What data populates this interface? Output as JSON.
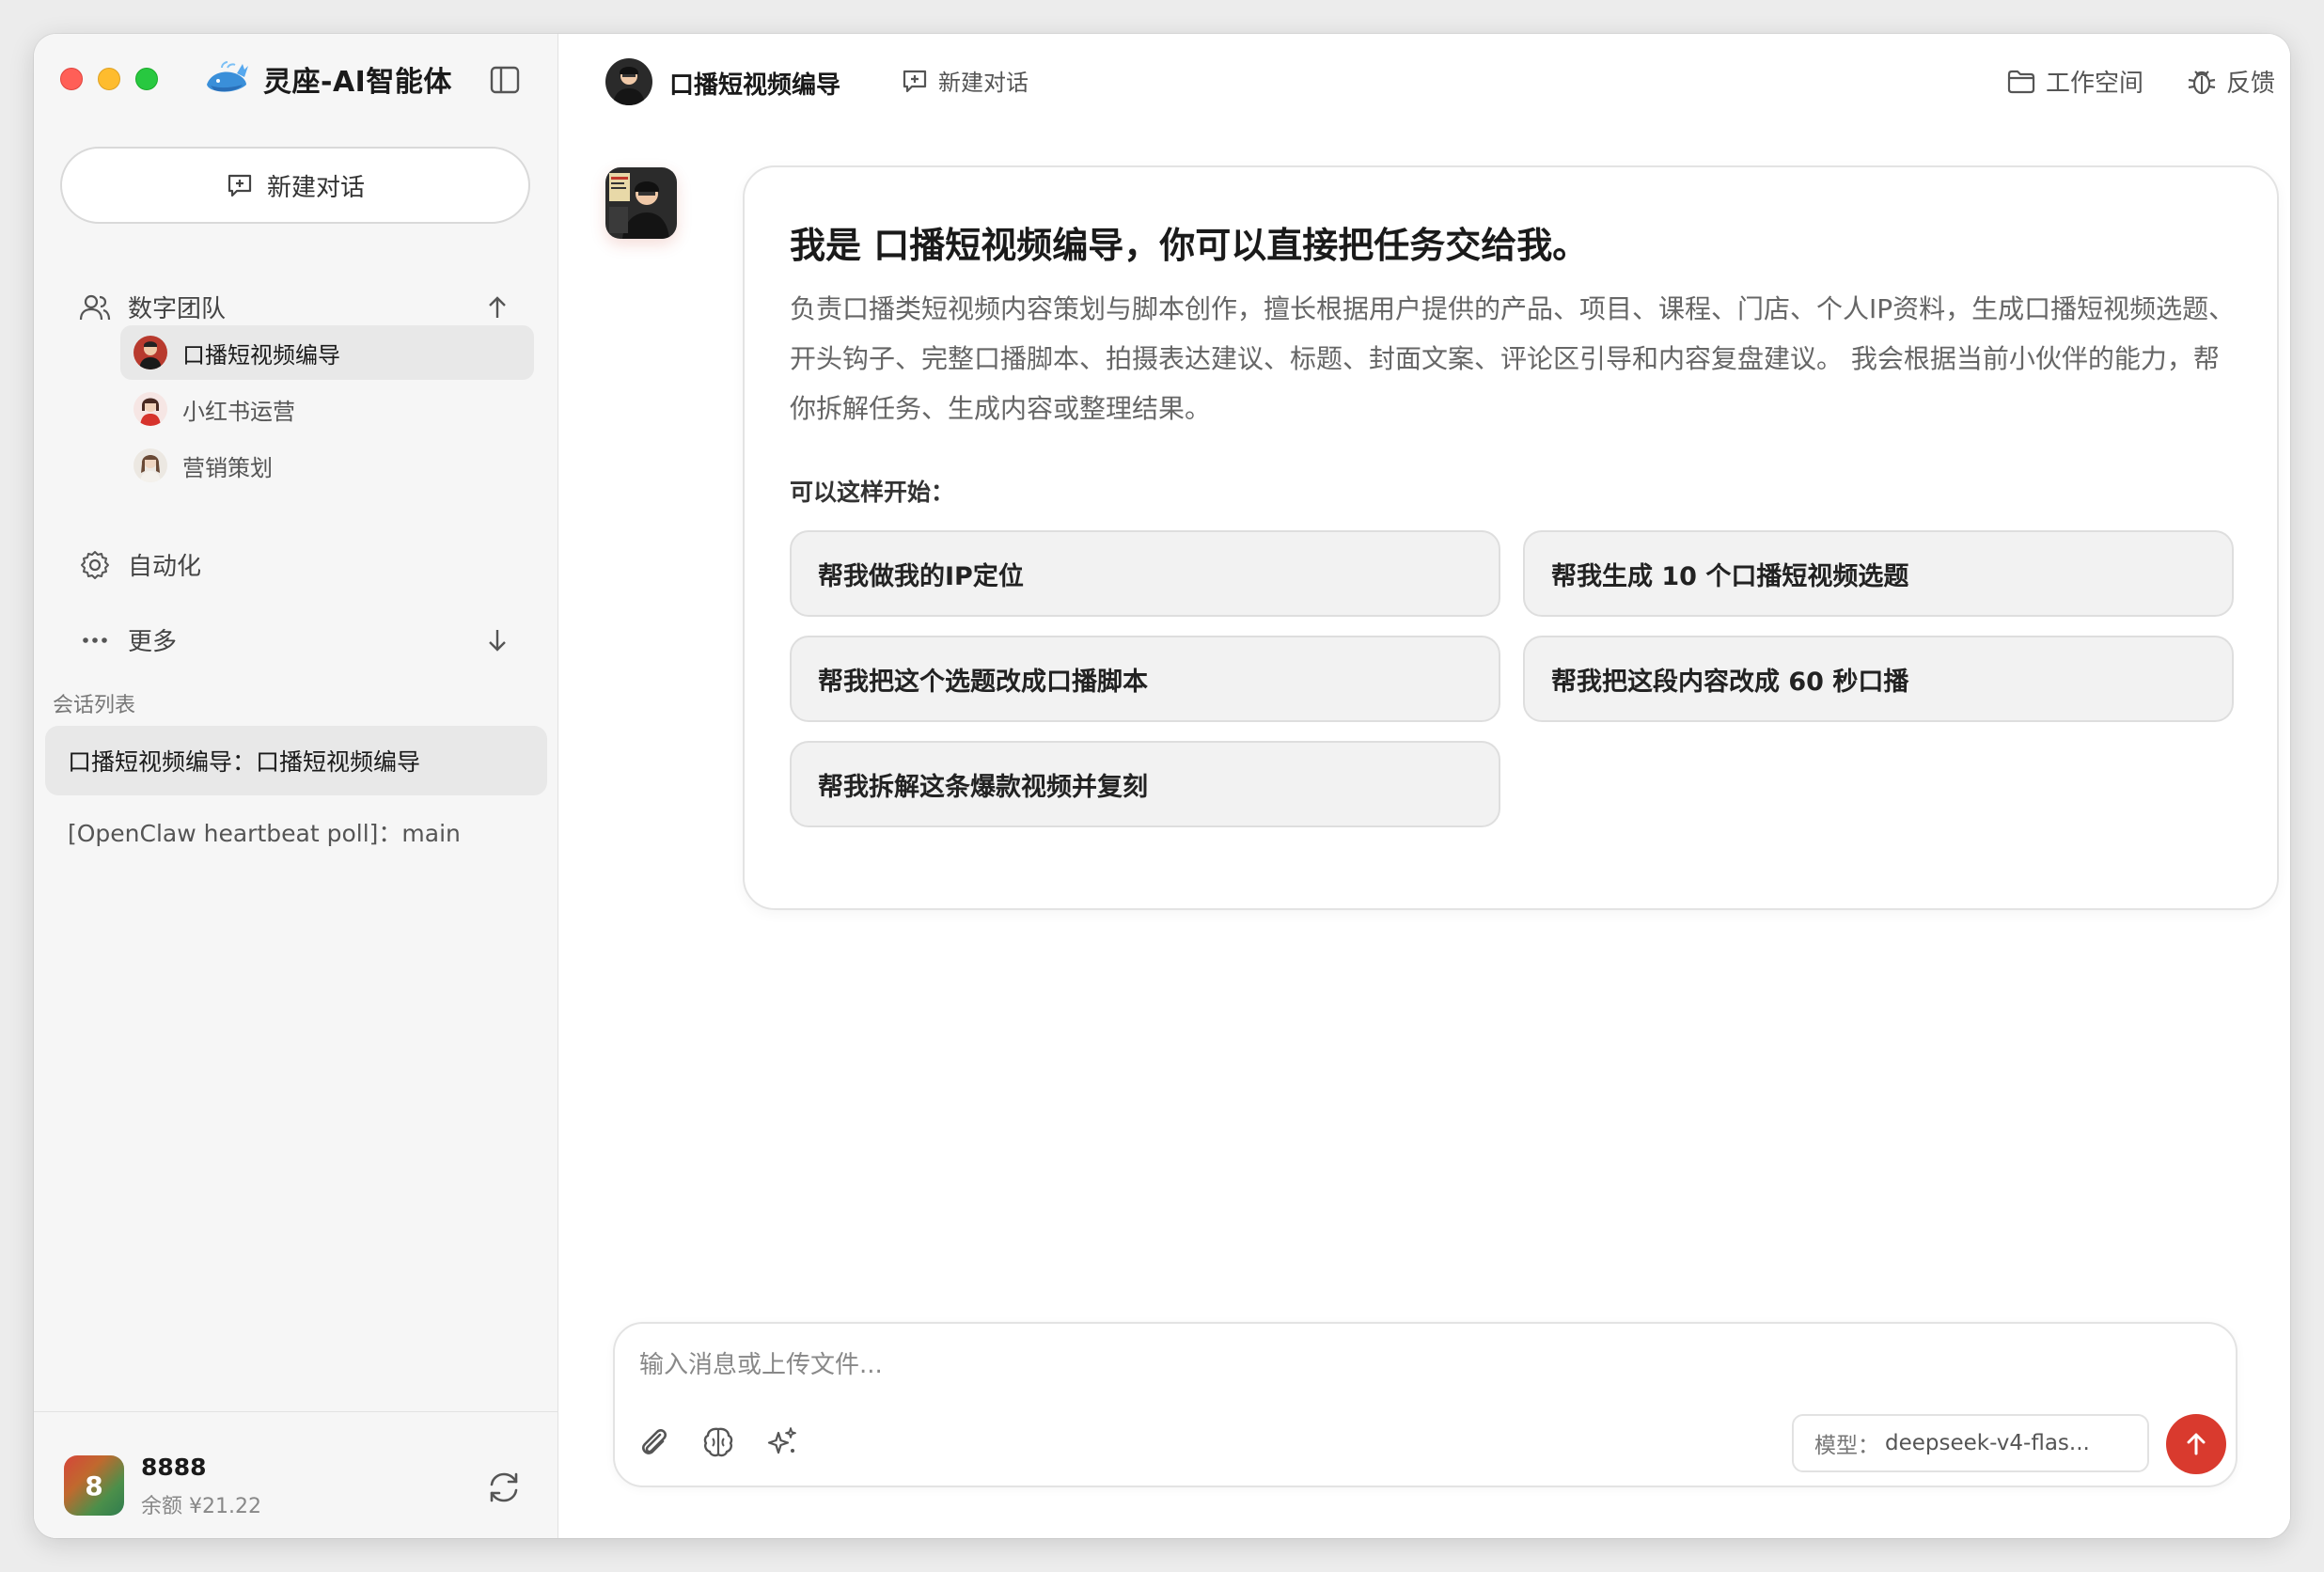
{
  "app": {
    "title": "灵座-AI智能体",
    "accent_color": "#d93a2e"
  },
  "sidebar": {
    "new_chat_label": "新建对话",
    "team": {
      "label": "数字团队",
      "members": [
        {
          "label": "口播短视频编导",
          "active": true
        },
        {
          "label": "小红书运营",
          "active": false
        },
        {
          "label": "营销策划",
          "active": false
        }
      ]
    },
    "automation_label": "自动化",
    "more_label": "更多",
    "conversations_label": "会话列表",
    "conversations": [
      {
        "label": "口播短视频编导：口播短视频编导",
        "active": true
      },
      {
        "label": "[OpenClaw heartbeat poll]：main",
        "active": false
      }
    ],
    "user": {
      "avatar_text": "8",
      "name": "8888",
      "balance": "余额 ¥21.22"
    }
  },
  "topbar": {
    "agent_name": "口播短视频编导",
    "new_chat_label": "新建对话",
    "workspace_label": "工作空间",
    "feedback_label": "反馈"
  },
  "intro": {
    "title": "我是 口播短视频编导，你可以直接把任务交给我。",
    "description": "负责口播类短视频内容策划与脚本创作，擅长根据用户提供的产品、项目、课程、门店、个人IP资料，生成口播短视频选题、开头钩子、完整口播脚本、拍摄表达建议、标题、封面文案、评论区引导和内容复盘建议。 我会根据当前小伙伴的能力，帮你拆解任务、生成内容或整理结果。",
    "hint": "可以这样开始：",
    "suggestions": [
      "帮我做我的IP定位",
      "帮我生成 10 个口播短视频选题",
      "帮我把这个选题改成口播脚本",
      "帮我把这段内容改成 60 秒口播",
      "帮我拆解这条爆款视频并复刻"
    ]
  },
  "composer": {
    "placeholder": "输入消息或上传文件...",
    "model_key": "模型：",
    "model_value": "deepseek-v4-flas..."
  }
}
